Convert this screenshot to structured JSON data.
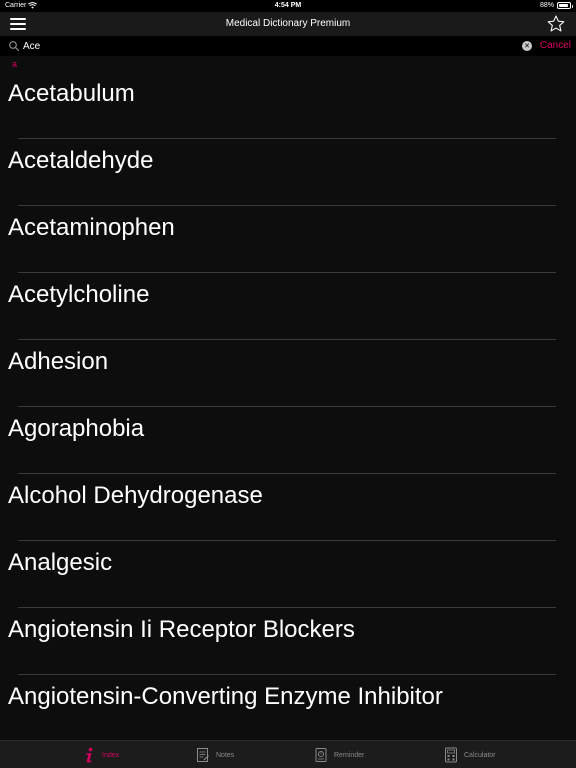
{
  "status_bar": {
    "carrier": "Carrier",
    "time": "4:54 PM",
    "battery": "88%",
    "battery_level": 0.88
  },
  "nav": {
    "title": "Medical Dictionary Premium",
    "menu_icon": "hamburger-icon",
    "favorite_icon": "star-icon"
  },
  "search": {
    "value": "Ace",
    "placeholder": "",
    "cancel_label": "Cancel",
    "icon": "search-icon",
    "clear_icon": "clear-icon"
  },
  "index": {
    "letter": "a"
  },
  "terms": [
    "Acetabulum",
    "Acetaldehyde",
    "Acetaminophen",
    "Acetylcholine",
    "Adhesion",
    "Agoraphobia",
    "Alcohol Dehydrogenase",
    "Analgesic",
    "Angiotensin Ii Receptor Blockers",
    "Angiotensin-Converting Enzyme Inhibitor"
  ],
  "tabs": [
    {
      "label": "Index",
      "icon": "info-icon",
      "active": true
    },
    {
      "label": "Notes",
      "icon": "notes-icon",
      "active": false
    },
    {
      "label": "Reminder",
      "icon": "reminder-icon",
      "active": false
    },
    {
      "label": "Calculator",
      "icon": "calculator-icon",
      "active": false
    }
  ],
  "colors": {
    "accent": "#d6005f",
    "background": "#0d0d0d",
    "bar": "#1a1a1a"
  }
}
